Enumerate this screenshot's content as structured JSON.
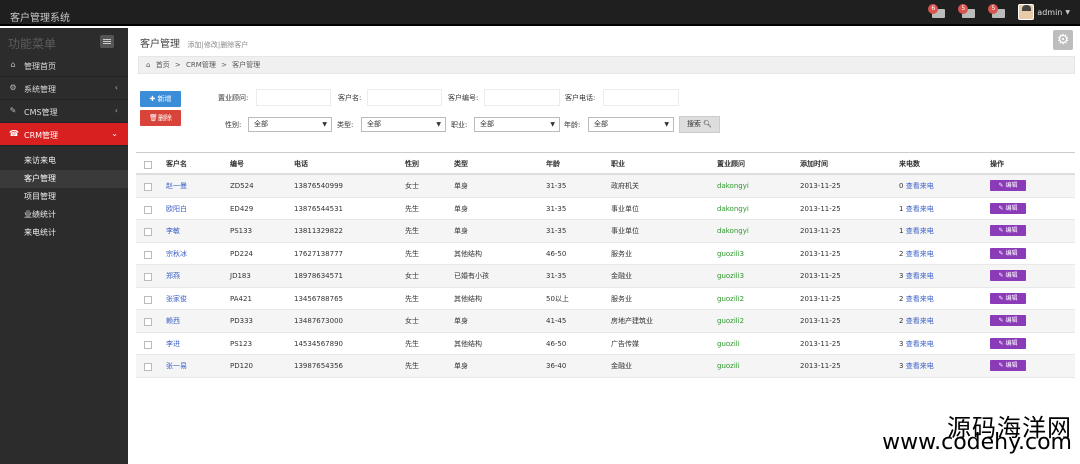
{
  "app": {
    "title": "客户管理系统"
  },
  "topbar": {
    "badges": [
      {
        "icon": "bell-icon",
        "count": "6"
      },
      {
        "icon": "mail-icon",
        "count": "5"
      },
      {
        "icon": "tasks-icon",
        "count": "5"
      }
    ],
    "user": "admin"
  },
  "sidebar": {
    "title": "功能菜单",
    "items": [
      {
        "label": "管理首页",
        "icon": "home-icon",
        "glyph": "⌂",
        "chevron": ""
      },
      {
        "label": "系统管理",
        "icon": "gear-icon",
        "glyph": "⚙",
        "chevron": "‹"
      },
      {
        "label": "CMS管理",
        "icon": "leaf-icon",
        "glyph": "✎",
        "chevron": "‹"
      },
      {
        "label": "CRM管理",
        "icon": "phone-icon",
        "glyph": "☎",
        "chevron": "⌄",
        "active": true
      }
    ],
    "sub_items": [
      "来访来电",
      "客户管理",
      "项目管理",
      "业绩统计",
      "来电统计"
    ]
  },
  "page": {
    "title": "客户管理",
    "subtitle": "添加|修改|删除客户",
    "breadcrumb": [
      "首页",
      ">",
      "CRM管理",
      ">",
      "客户管理"
    ]
  },
  "toolbar": {
    "add_label": "新增",
    "delete_label": "删除"
  },
  "filters": {
    "consultant_label": "置业顾问:",
    "name_label": "客户名:",
    "code_label": "客户编号:",
    "phone_label": "客户电话:",
    "consultant_value": "",
    "name_value": "",
    "code_value": "",
    "phone_value": "",
    "gender_label": "性别:",
    "type_label": "类型:",
    "job_label": "职业:",
    "age_label": "年龄:",
    "gender_value": "全部",
    "type_value": "全部",
    "job_value": "全部",
    "age_value": "全部",
    "search_label": "搜索"
  },
  "table": {
    "headers": [
      "客户名",
      "编号",
      "电话",
      "性别",
      "类型",
      "年龄",
      "职业",
      "置业顾问",
      "添加时间",
      "来电数",
      "操作"
    ],
    "edit_label": "编辑",
    "rows": [
      {
        "name": "赵一曼",
        "code": "ZD524",
        "phone": "13876540999",
        "gender": "女士",
        "type": "单身",
        "age": "31-35",
        "job": "政府机关",
        "consultant": "dakongyi",
        "date": "2013-11-25",
        "calls": "0",
        "calls_link": "查看来电"
      },
      {
        "name": "欧阳白",
        "code": "ED429",
        "phone": "13876544531",
        "gender": "先生",
        "type": "单身",
        "age": "31-35",
        "job": "事业单位",
        "consultant": "dakongyi",
        "date": "2013-11-25",
        "calls": "1",
        "calls_link": "查看来电"
      },
      {
        "name": "李敏",
        "code": "PS133",
        "phone": "13811329822",
        "gender": "先生",
        "type": "单身",
        "age": "31-35",
        "job": "事业单位",
        "consultant": "dakongyi",
        "date": "2013-11-25",
        "calls": "1",
        "calls_link": "查看来电"
      },
      {
        "name": "宗秋冰",
        "code": "PD224",
        "phone": "17627138777",
        "gender": "先生",
        "type": "其他结构",
        "age": "46-50",
        "job": "服务业",
        "consultant": "guozili3",
        "date": "2013-11-25",
        "calls": "2",
        "calls_link": "查看来电"
      },
      {
        "name": "郑燕",
        "code": "JD183",
        "phone": "18978634571",
        "gender": "女士",
        "type": "已婚有小孩",
        "age": "31-35",
        "job": "金融业",
        "consultant": "guozili3",
        "date": "2013-11-25",
        "calls": "3",
        "calls_link": "查看来电"
      },
      {
        "name": "张家俊",
        "code": "PA421",
        "phone": "13456788765",
        "gender": "先生",
        "type": "其他结构",
        "age": "50以上",
        "job": "服务业",
        "consultant": "guozili2",
        "date": "2013-11-25",
        "calls": "2",
        "calls_link": "查看来电"
      },
      {
        "name": "赖西",
        "code": "PD333",
        "phone": "13487673000",
        "gender": "女士",
        "type": "单身",
        "age": "41-45",
        "job": "房地产建筑业",
        "consultant": "guozili2",
        "date": "2013-11-25",
        "calls": "2",
        "calls_link": "查看来电"
      },
      {
        "name": "李进",
        "code": "PS123",
        "phone": "14534567890",
        "gender": "先生",
        "type": "其他结构",
        "age": "46-50",
        "job": "广告传媒",
        "consultant": "guozili",
        "date": "2013-11-25",
        "calls": "3",
        "calls_link": "查看来电"
      },
      {
        "name": "张一易",
        "code": "PD120",
        "phone": "13987654356",
        "gender": "先生",
        "type": "单身",
        "age": "36-40",
        "job": "金融业",
        "consultant": "guozili",
        "date": "2013-11-25",
        "calls": "3",
        "calls_link": "查看来电"
      }
    ]
  },
  "watermark": {
    "line1": "源码海洋网",
    "line2": "www.codehy.com"
  },
  "colors": {
    "accent": "#d82020",
    "primary": "#3c8dd8",
    "danger": "#d9443a",
    "edit": "#8b3ab8",
    "topbar": "#1f1f1f",
    "sidebar": "#2c2c2c"
  }
}
